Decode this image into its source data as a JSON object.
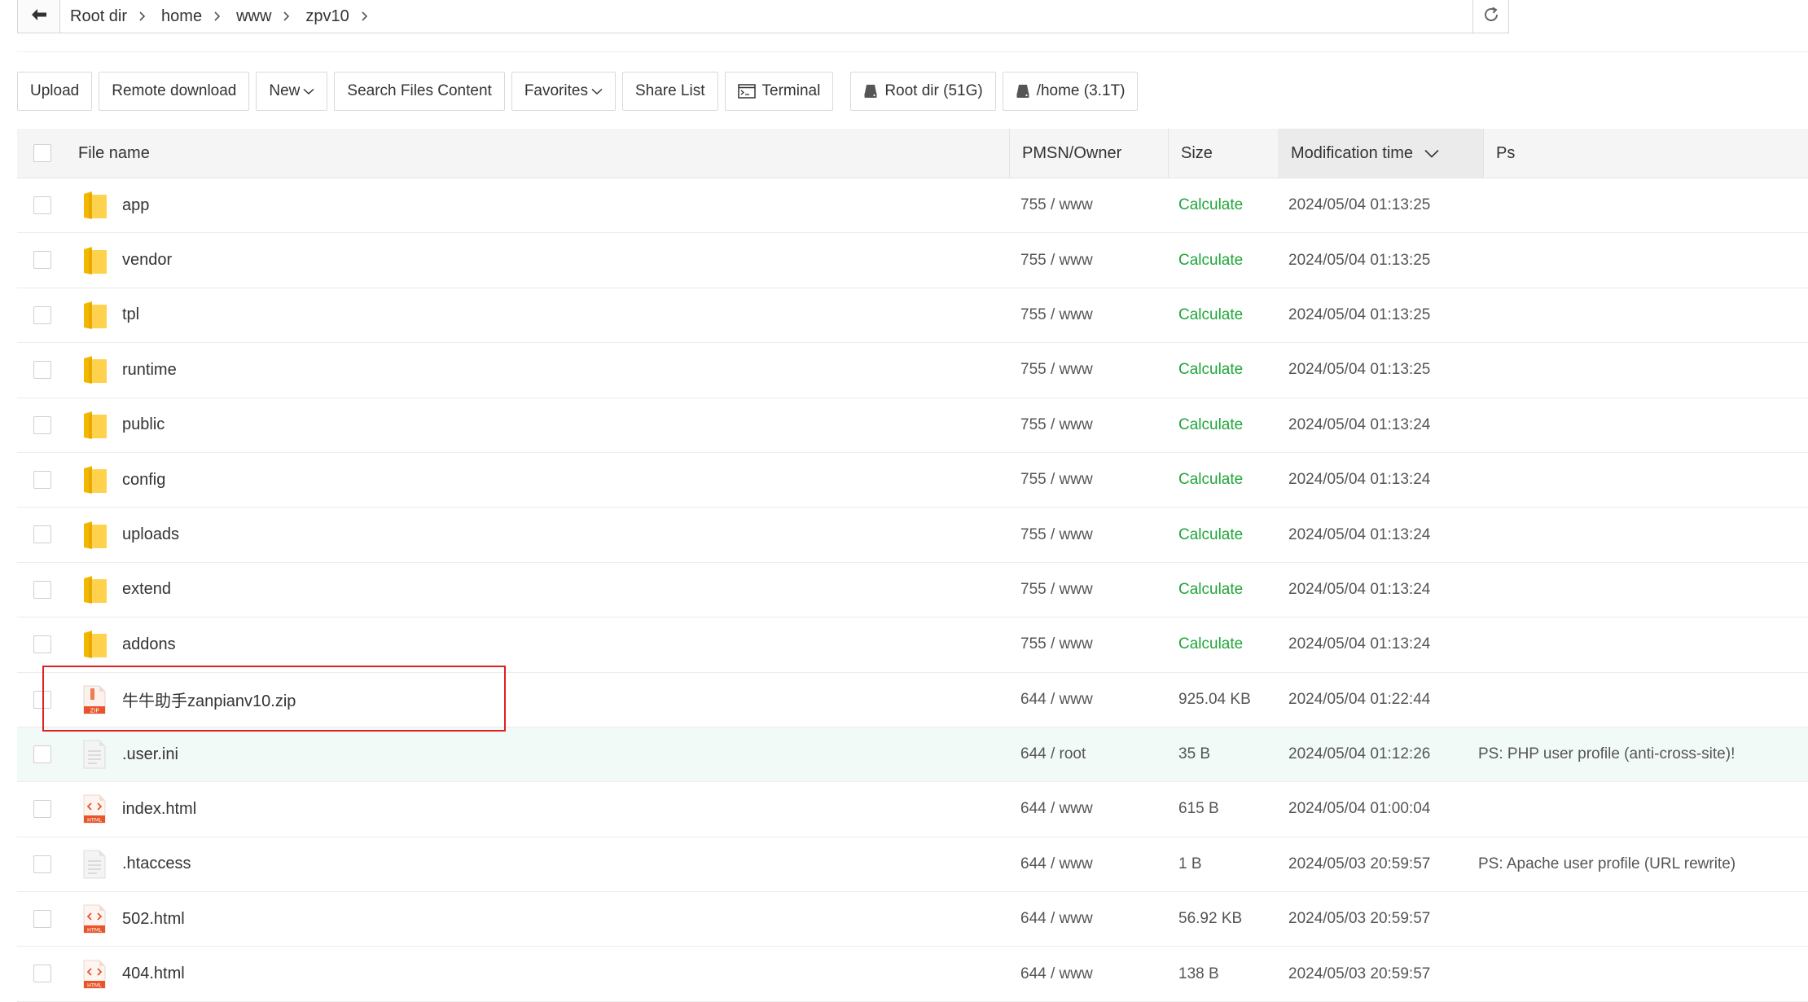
{
  "breadcrumb": [
    "Root dir",
    "home",
    "www",
    "zpv10"
  ],
  "toolbar": {
    "upload": "Upload",
    "remote_download": "Remote download",
    "new": "New",
    "search_content": "Search Files Content",
    "favorites": "Favorites",
    "share_list": "Share List",
    "terminal": "Terminal",
    "disk_root": "Root dir (51G)",
    "disk_home": "/home (3.1T)"
  },
  "columns": {
    "name": "File name",
    "owner": "PMSN/Owner",
    "size": "Size",
    "mtime": "Modification time",
    "ps": "Ps"
  },
  "rows": [
    {
      "name": "app",
      "type": "folder",
      "owner": "755 / www",
      "size": "Calculate",
      "mtime": "2024/05/04 01:13:25",
      "ps": ""
    },
    {
      "name": "vendor",
      "type": "folder",
      "owner": "755 / www",
      "size": "Calculate",
      "mtime": "2024/05/04 01:13:25",
      "ps": ""
    },
    {
      "name": "tpl",
      "type": "folder",
      "owner": "755 / www",
      "size": "Calculate",
      "mtime": "2024/05/04 01:13:25",
      "ps": ""
    },
    {
      "name": "runtime",
      "type": "folder",
      "owner": "755 / www",
      "size": "Calculate",
      "mtime": "2024/05/04 01:13:25",
      "ps": ""
    },
    {
      "name": "public",
      "type": "folder",
      "owner": "755 / www",
      "size": "Calculate",
      "mtime": "2024/05/04 01:13:24",
      "ps": ""
    },
    {
      "name": "config",
      "type": "folder",
      "owner": "755 / www",
      "size": "Calculate",
      "mtime": "2024/05/04 01:13:24",
      "ps": ""
    },
    {
      "name": "uploads",
      "type": "folder",
      "owner": "755 / www",
      "size": "Calculate",
      "mtime": "2024/05/04 01:13:24",
      "ps": ""
    },
    {
      "name": "extend",
      "type": "folder",
      "owner": "755 / www",
      "size": "Calculate",
      "mtime": "2024/05/04 01:13:24",
      "ps": ""
    },
    {
      "name": "addons",
      "type": "folder",
      "owner": "755 / www",
      "size": "Calculate",
      "mtime": "2024/05/04 01:13:24",
      "ps": ""
    },
    {
      "name": "牛牛助手zanpianv10.zip",
      "type": "zip",
      "owner": "644 / www",
      "size": "925.04 KB",
      "mtime": "2024/05/04 01:22:44",
      "ps": ""
    },
    {
      "name": ".user.ini",
      "type": "text",
      "owner": "644 / root",
      "size": "35 B",
      "mtime": "2024/05/04 01:12:26",
      "ps": "PS: PHP user profile (anti-cross-site)!"
    },
    {
      "name": "index.html",
      "type": "html",
      "owner": "644 / www",
      "size": "615 B",
      "mtime": "2024/05/04 01:00:04",
      "ps": ""
    },
    {
      "name": ".htaccess",
      "type": "text",
      "owner": "644 / www",
      "size": "1 B",
      "mtime": "2024/05/03 20:59:57",
      "ps": "PS: Apache user profile (URL rewrite)"
    },
    {
      "name": "502.html",
      "type": "html",
      "owner": "644 / www",
      "size": "56.92 KB",
      "mtime": "2024/05/03 20:59:57",
      "ps": ""
    },
    {
      "name": "404.html",
      "type": "html",
      "owner": "644 / www",
      "size": "138 B",
      "mtime": "2024/05/03 20:59:57",
      "ps": ""
    }
  ],
  "colors": {
    "calculate": "#20a53a",
    "highlight_row": "#f2faf7",
    "annotation_box": "#e02020",
    "folder": "#ffd24d"
  }
}
